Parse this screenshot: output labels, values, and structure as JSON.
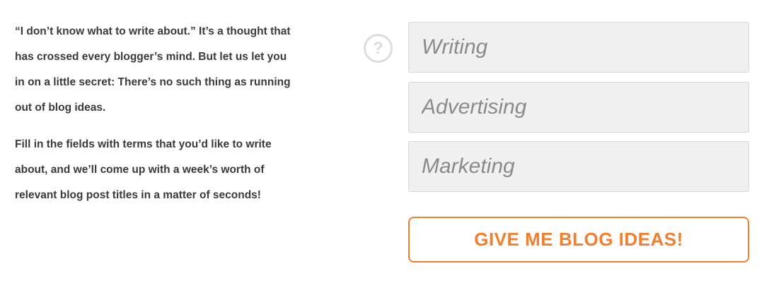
{
  "intro": {
    "paragraph_1": "“I don’t know what to write about.” It’s a thought that has crossed every blogger’s mind. But let us let you in on a little secret: There’s no such thing as running out of blog ideas.",
    "paragraph_2": "Fill in the fields with terms that you’d like to write about, and we’ll come up with a week’s worth of relevant blog post titles in a matter of seconds!"
  },
  "help": {
    "icon": "question-circle-icon",
    "glyph": "?"
  },
  "form": {
    "fields": [
      {
        "placeholder": "Writing",
        "value": ""
      },
      {
        "placeholder": "Advertising",
        "value": ""
      },
      {
        "placeholder": "Marketing",
        "value": ""
      }
    ],
    "submit_label": "GIVE ME BLOG IDEAS!"
  },
  "colors": {
    "accent": "#f07f2f",
    "text": "#3a3a3a",
    "field_background": "#f0f0f0",
    "placeholder": "#8a8a8a",
    "help_icon": "#dcdcdc"
  }
}
